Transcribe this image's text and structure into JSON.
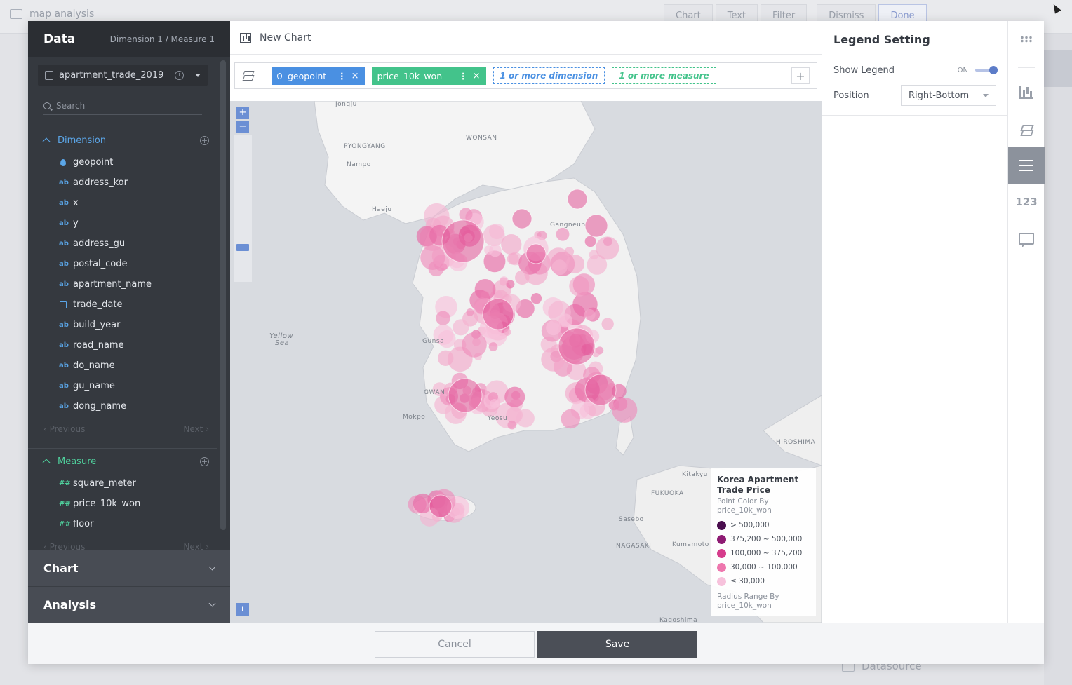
{
  "background": {
    "app_title": "map analysis",
    "toolbar": [
      "Chart",
      "Text",
      "Filter",
      "Dismiss",
      "Done"
    ],
    "bottom_label": "Datasource"
  },
  "left": {
    "title": "Data",
    "subtitle": "Dimension 1 / Measure 1",
    "datasource": "apartment_trade_2019",
    "search_placeholder": "Search",
    "dimension_label": "Dimension",
    "dimensions": [
      {
        "name": "geopoint",
        "type": "geo"
      },
      {
        "name": "address_kor",
        "type": "ab"
      },
      {
        "name": "x",
        "type": "ab"
      },
      {
        "name": "y",
        "type": "ab"
      },
      {
        "name": "address_gu",
        "type": "ab"
      },
      {
        "name": "postal_code",
        "type": "ab"
      },
      {
        "name": "apartment_name",
        "type": "ab"
      },
      {
        "name": "trade_date",
        "type": "date"
      },
      {
        "name": "build_year",
        "type": "ab"
      },
      {
        "name": "road_name",
        "type": "ab"
      },
      {
        "name": "do_name",
        "type": "ab"
      },
      {
        "name": "gu_name",
        "type": "ab"
      },
      {
        "name": "dong_name",
        "type": "ab"
      }
    ],
    "measure_label": "Measure",
    "measures": [
      {
        "name": "square_meter",
        "type": "##"
      },
      {
        "name": "price_10k_won",
        "type": "##"
      },
      {
        "name": "floor",
        "type": "##"
      }
    ],
    "previous": "Previous",
    "next": "Next",
    "chart_section": "Chart",
    "analysis_section": "Analysis"
  },
  "center": {
    "title": "New Chart",
    "shelf": {
      "dim_pill": "geopoint",
      "mea_pill": "price_10k_won",
      "dim_placeholder": "1 or more dimension",
      "mea_placeholder": "1 or more measure"
    },
    "map_labels": {
      "jongju": "Jongju",
      "pyongyang": "PYONGYANG",
      "wonsan": "WONSAN",
      "nampo": "Nampo",
      "haeju": "Haeju",
      "gangneung": "Gangneun",
      "yellow": "Yellow",
      "sea": "Sea",
      "gunsa": "Gunsa",
      "gwang": "GWAN",
      "mokpo": "Mokpo",
      "yeosu": "Yeosu",
      "hiroshima": "HIROSHIMA",
      "kitakyu": "Kitakyu",
      "fukuoka": "FUKUOKA",
      "sasebo": "Sasebo",
      "nagasaki": "NAGASAKI",
      "kumamoto": "Kumamoto",
      "kagoshima": "Kagoshima"
    },
    "legend": {
      "title": "Korea Apartment Trade Price",
      "color_by": "Point Color By price_10k_won",
      "items": [
        {
          "label": "> 500,000",
          "color": "#4a0e4e"
        },
        {
          "label": "375,200 ~ 500,000",
          "color": "#8e1b73"
        },
        {
          "label": "100,000 ~ 375,200",
          "color": "#d63c8c"
        },
        {
          "label": "30,000 ~ 100,000",
          "color": "#ee77ae"
        },
        {
          "label": "≤ 30,000",
          "color": "#f7c2dc"
        }
      ],
      "radius_by": "Radius Range By price_10k_won"
    }
  },
  "right": {
    "title": "Legend Setting",
    "show_legend_label": "Show Legend",
    "show_legend_state": "ON",
    "position_label": "Position",
    "position_value": "Right-Bottom"
  },
  "rail": {
    "number_label": "123"
  },
  "footer": {
    "cancel": "Cancel",
    "save": "Save"
  }
}
